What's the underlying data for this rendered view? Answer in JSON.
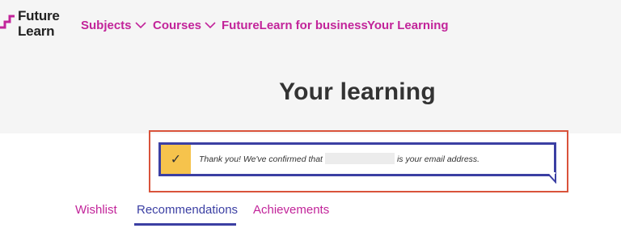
{
  "brand": {
    "line1": "Future",
    "line2": "Learn",
    "accent_color": "#c2249a"
  },
  "nav": {
    "items": [
      {
        "label": "Subjects",
        "dropdown": true
      },
      {
        "label": "Courses",
        "dropdown": true
      },
      {
        "label": "FutureLearn for business",
        "dropdown": false
      },
      {
        "label": "Your Learning",
        "dropdown": false
      }
    ]
  },
  "page": {
    "title": "Your learning"
  },
  "notice": {
    "icon": "check-icon",
    "text_before": "Thank you! We've confirmed that",
    "text_after": "is your email address.",
    "accent_color": "#f6c34c",
    "border_color": "#3b3fa3"
  },
  "tabs": {
    "items": [
      {
        "label": "Wishlist",
        "active": false
      },
      {
        "label": "Recommendations",
        "active": true
      },
      {
        "label": "Achievements",
        "active": false
      }
    ],
    "active_color": "#3b3fa3"
  }
}
